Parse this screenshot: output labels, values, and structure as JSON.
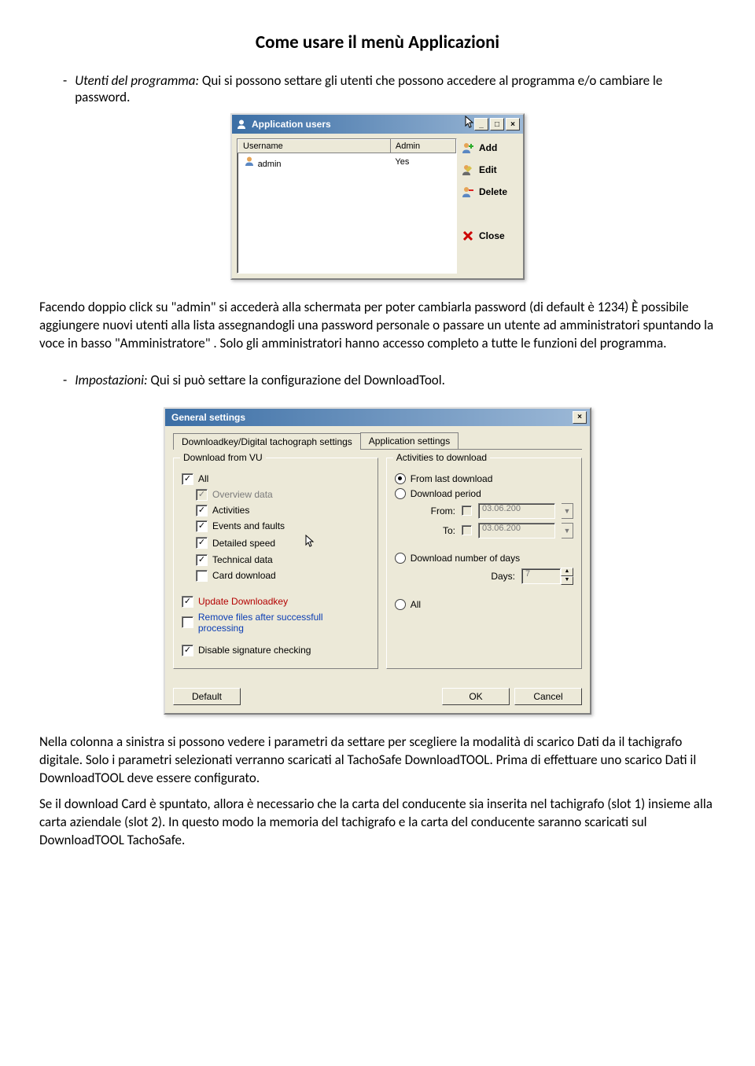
{
  "title": "Come usare il menù Applicazioni",
  "para1_prefix": "Utenti del programma:",
  "para1_rest": " Qui si possono settare gli utenti che possono accedere al programma e/o cambiare le password.",
  "win1": {
    "title": "Application users",
    "cols": {
      "username": "Username",
      "admin": "Admin"
    },
    "row": {
      "username": "admin",
      "admin": "Yes"
    },
    "actions": {
      "add": "Add",
      "edit": "Edit",
      "delete": "Delete",
      "close": "Close"
    }
  },
  "para2": "Facendo doppio click su \"admin\" si accederà alla schermata per poter cambiarla password (di default è 1234) È possibile aggiungere nuovi utenti alla lista assegnandogli una password personale o passare un utente ad amministratori spuntando la voce in basso \"Amministratore\" . Solo gli amministratori hanno accesso completo a tutte le funzioni del programma.",
  "para3_prefix": "Impostazioni:",
  "para3_rest": " Qui si può settare la configurazione del DownloadTool.",
  "win2": {
    "title": "General settings",
    "tabs": {
      "t1": "Downloadkey/Digital tachograph settings",
      "t2": "Application settings"
    },
    "group_left": "Download from VU",
    "chk": {
      "all": "All",
      "overview": "Overview data",
      "activities": "Activities",
      "events": "Events and faults",
      "detailed": "Detailed speed",
      "technical": "Technical data",
      "carddl": "Card download",
      "updatekey": "Update Downloadkey",
      "removefiles": "Remove files after successfull processing",
      "disablesig": "Disable signature checking"
    },
    "group_right": "Activities to download",
    "rad": {
      "fromlast": "From last download",
      "period": "Download period",
      "numdays": "Download number of days",
      "all": "All"
    },
    "labels": {
      "from": "From:",
      "to": "To:",
      "days": "Days:"
    },
    "values": {
      "from": "03.06.200",
      "to": "03.06.200",
      "days": "7"
    },
    "buttons": {
      "default": "Default",
      "ok": "OK",
      "cancel": "Cancel"
    }
  },
  "para4": "Nella colonna a sinistra si possono vedere i parametri da settare per scegliere la modalità di scarico Dati da il tachigrafo digitale. Solo i parametri selezionati verranno scaricati al TachoSafe DownloadTOOL. Prima di effettuare uno scarico Dati il DownloadTOOL deve essere configurato.",
  "para5": "Se il download Card è spuntato, allora è necessario che la carta del conducente sia inserita nel tachigrafo (slot 1) insieme alla carta aziendale (slot 2). In questo modo la memoria del tachigrafo e la carta del conducente saranno scaricati sul DownloadTOOL TachoSafe."
}
